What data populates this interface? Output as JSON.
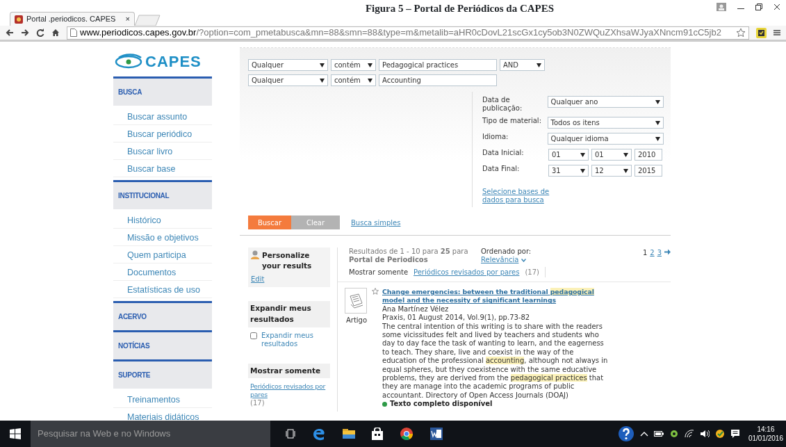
{
  "caption": "Figura 5 – Portal de Periódicos da CAPES",
  "browser": {
    "tab_title": "Portal .periodicos. CAPES",
    "tab_close": "×",
    "url_host": "www.periodicos.capes.gov.br",
    "url_rest": "/?option=com_pmetabusca&mn=88&smn=88&type=m&metalib=aHR0cDovL21scGx1cy5ob3N0ZWQuZXhsaWJyaXNncm91cC5jb2"
  },
  "sidebar": {
    "logo": "CAPES",
    "sections": [
      {
        "title": "BUSCA",
        "items": [
          "Buscar assunto",
          "Buscar periódico",
          "Buscar livro",
          "Buscar base"
        ]
      },
      {
        "title": "INSTITUCIONAL",
        "items": [
          "Histórico",
          "Missão e objetivos",
          "Quem participa",
          "Documentos",
          "Estatísticas de uso"
        ]
      },
      {
        "title": "ACERVO"
      },
      {
        "title": "NOTÍCIAS"
      },
      {
        "title": "SUPORTE",
        "items": [
          "Treinamentos",
          "Materiais didáticos"
        ]
      }
    ]
  },
  "search": {
    "rows": [
      {
        "field": "Qualquer",
        "operator": "contém",
        "term": "Pedagogical practices",
        "boolean": "AND"
      },
      {
        "field": "Qualquer",
        "operator": "contém",
        "term": "Accounting"
      }
    ],
    "filters": [
      {
        "label": "Data de publicação:",
        "kind": "select",
        "value": "Qualquer ano"
      },
      {
        "label": "Tipo de material:",
        "kind": "select",
        "value": "Todos os itens"
      },
      {
        "label": "Idioma:",
        "kind": "select",
        "value": "Qualquer idioma"
      },
      {
        "label": "Data Inicial:",
        "kind": "date",
        "day": "01",
        "month": "01",
        "year": "2010"
      },
      {
        "label": "Data Final:",
        "kind": "date",
        "day": "31",
        "month": "12",
        "year": "2015"
      }
    ],
    "databases_link": "Selecione bases de dados para busca",
    "buttons": [
      {
        "label": "Buscar",
        "kind": "primary"
      },
      {
        "label": "Clear",
        "kind": "secondary"
      }
    ],
    "simple_link": "Busca simples"
  },
  "refine": {
    "personalize": {
      "title": "Personalize your results",
      "edit": "Edit"
    },
    "expand": {
      "title": "Expandir meus resultados",
      "option": {
        "label": "Expandir meus resultados",
        "checked": false
      }
    },
    "show_only": {
      "title": "Mostrar somente",
      "link": "Periódicos revisados por pares",
      "count": "(17)"
    }
  },
  "results": {
    "summary": "Resultados de 1 - 10 para **25** para **Portal de Periodicos**",
    "sort_label": "Ordenado por:",
    "sort_value": "Relevância",
    "pages": [
      {
        "label": "1",
        "selected": true
      },
      {
        "label": "2",
        "selected": false
      },
      {
        "label": "3",
        "selected": false
      }
    ],
    "filter_label": "Mostrar somente",
    "filter_link": "Periódicos revisados por pares",
    "filter_count": "(17)",
    "items": [
      {
        "type_label": "Artigo",
        "starred": false,
        "title": [
          {
            "text": "Change emergencies: between the traditional ",
            "highlight": false
          },
          {
            "text": "pedagogical",
            "highlight": true
          },
          {
            "text": " model and the necessity of significant learnings",
            "highlight": false
          }
        ],
        "author": "Ana Martínez Vélez",
        "source": "Praxis, 01 August 2014, Vol.9(1), pp.73-82",
        "abstract": [
          {
            "text": "The central intention of this writing is to share with the readers some vicissitudes felt and lived by teachers and students who day to day face the task of wanting to learn, and the eagerness to teach. They share, live and coexist in the way of the education of the professional ",
            "highlight": false
          },
          {
            "text": "accounting",
            "highlight": true
          },
          {
            "text": ", although not always in equal spheres, but they coexistence with the same educative problems, they are derived from the ",
            "highlight": false
          },
          {
            "text": "pedagogical practices",
            "highlight": true
          },
          {
            "text": " that they are manage into the academic programs of public accountant.  Directory of Open Access Journals (DOAJ)",
            "highlight": false
          }
        ],
        "availability": "Texto completo disponível"
      }
    ]
  },
  "taskbar": {
    "search_placeholder": "Pesquisar na Web e no Windows",
    "time": "14:16",
    "date": "01/01/2016"
  }
}
